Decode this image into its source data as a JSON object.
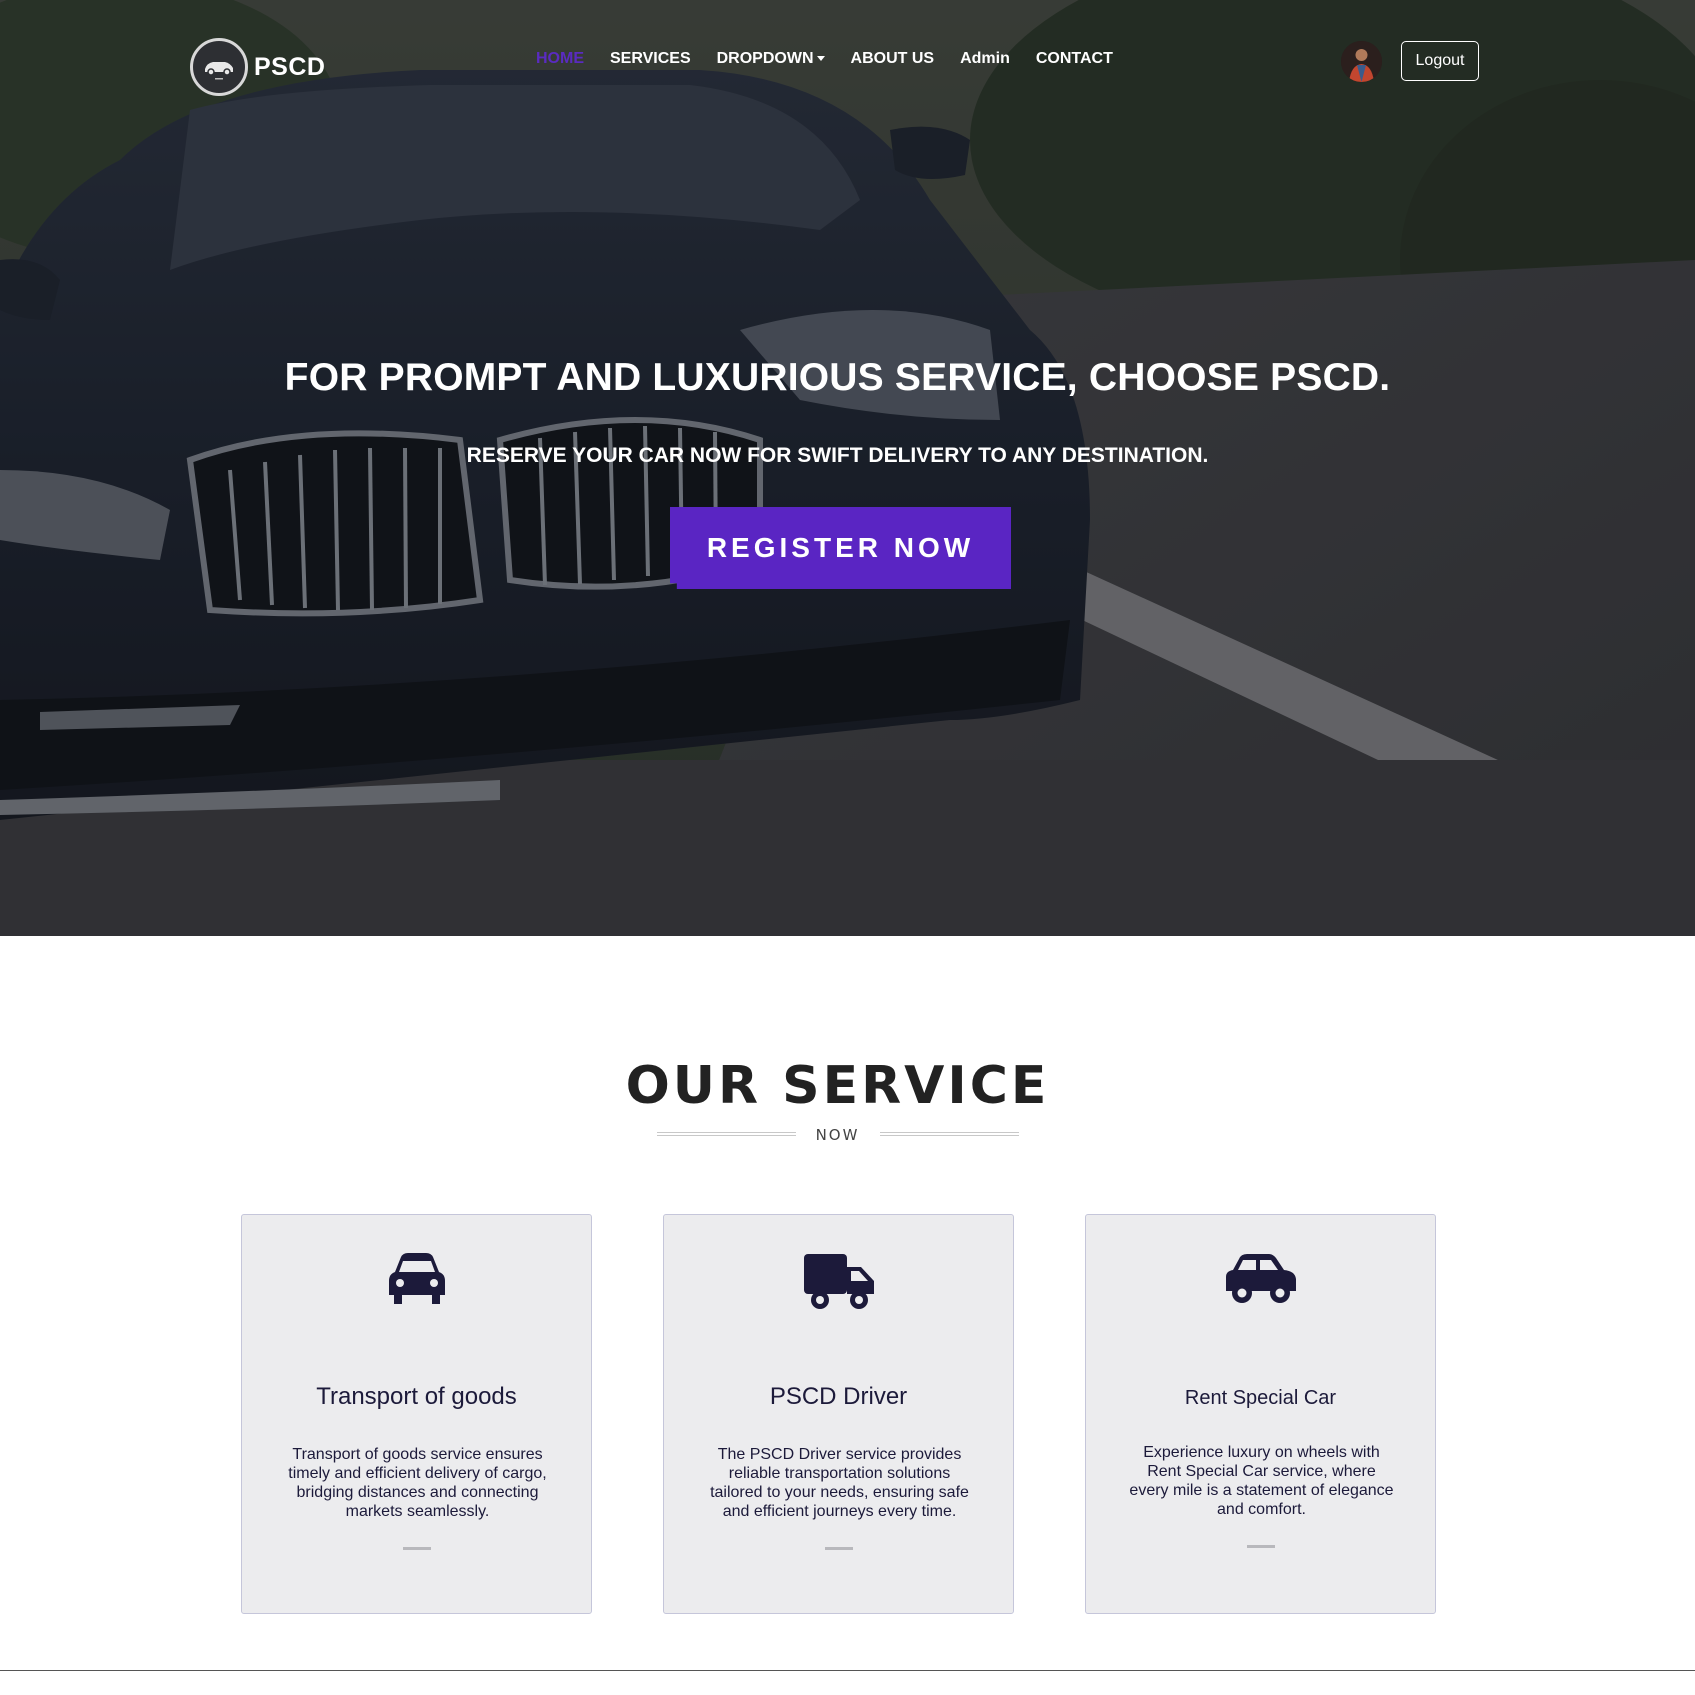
{
  "nav": {
    "brand": "PSCD",
    "links": [
      {
        "label": "HOME",
        "active": true
      },
      {
        "label": "SERVICES"
      },
      {
        "label": "DROPDOWN",
        "dropdown": true
      },
      {
        "label": "ABOUT US"
      },
      {
        "label": "Admin"
      },
      {
        "label": "CONTACT"
      }
    ],
    "logout_label": "Logout"
  },
  "hero": {
    "title": "FOR PROMPT AND LUXURIOUS SERVICE, CHOOSE PSCD.",
    "subtitle": "RESERVE YOUR CAR NOW FOR SWIFT DELIVERY TO ANY DESTINATION.",
    "cta_label": "REGISTER NOW"
  },
  "services": {
    "title": "OUR SERVICE",
    "subtitle": "NOW",
    "cards": [
      {
        "icon": "car-icon",
        "title": "Transport of goods",
        "text": "Transport of goods service ensures timely and efficient delivery of cargo, bridging distances and connecting markets seamlessly."
      },
      {
        "icon": "truck-icon",
        "title": "PSCD Driver",
        "text": "The PSCD Driver service provides reliable transportation solutions tailored to your needs, ensuring safe and efficient journeys every time."
      },
      {
        "icon": "car-side-icon",
        "title": "Rent Special Car",
        "text": "Experience luxury on wheels with Rent Special Car service, where every mile is a statement of elegance and comfort."
      }
    ]
  },
  "colors": {
    "accent": "#5a25c3",
    "card_bg": "#ececee",
    "icon": "#1c1a3a"
  }
}
